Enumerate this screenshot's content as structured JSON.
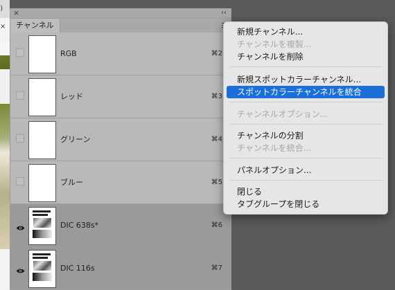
{
  "canvas": {
    "tab_text": "o) ×"
  },
  "panel": {
    "tab_label": "チャンネル",
    "channels": [
      {
        "name": "RGB",
        "shortcut": "⌘2",
        "visible": false,
        "selected": false
      },
      {
        "name": "レッド",
        "shortcut": "⌘3",
        "visible": false,
        "selected": false
      },
      {
        "name": "グリーン",
        "shortcut": "⌘4",
        "visible": false,
        "selected": false
      },
      {
        "name": "ブルー",
        "shortcut": "⌘5",
        "visible": false,
        "selected": false
      },
      {
        "name": "DIC 638s*",
        "shortcut": "⌘6",
        "visible": true,
        "selected": true
      },
      {
        "name": "DIC 116s",
        "shortcut": "⌘7",
        "visible": true,
        "selected": true
      }
    ]
  },
  "menu": {
    "items": [
      {
        "label": "新規チャンネル...",
        "disabled": false
      },
      {
        "label": "チャンネルを複製...",
        "disabled": true
      },
      {
        "label": "チャンネルを削除",
        "disabled": false
      },
      {
        "label": "新規スポットカラーチャンネル...",
        "disabled": false
      },
      {
        "label": "スポットカラーチャンネルを統合",
        "disabled": false,
        "highlighted": true
      },
      {
        "label": "チャンネルオプション...",
        "disabled": true
      },
      {
        "label": "チャンネルの分割",
        "disabled": false
      },
      {
        "label": "チャンネルを統合...",
        "disabled": true
      },
      {
        "label": "パネルオプション...",
        "disabled": false
      },
      {
        "label": "閉じる",
        "disabled": false
      },
      {
        "label": "タブグループを閉じる",
        "disabled": false
      }
    ]
  },
  "colors": {
    "highlight": "#1a6fd8",
    "panel_bg": "#b9b9b9",
    "selected_row": "#9a9a9a"
  }
}
